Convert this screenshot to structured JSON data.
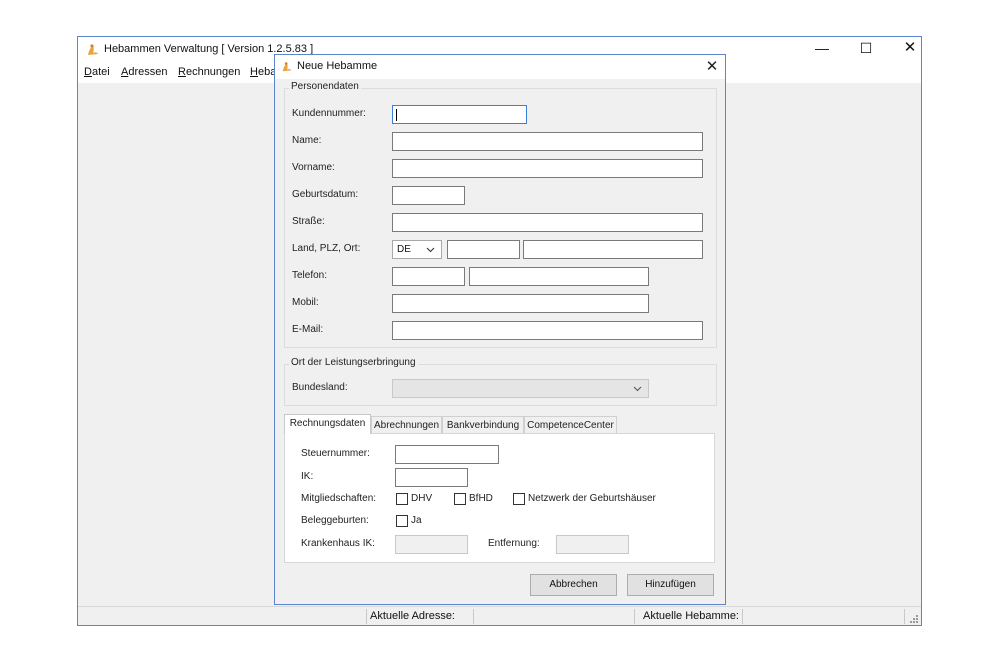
{
  "main": {
    "title": "Hebammen Verwaltung [ Version 1.2.5.83 ]",
    "controls": {
      "minimize": "—",
      "maximize": "☐",
      "close": "✕"
    },
    "menu": [
      {
        "underline": "D",
        "rest": "atei"
      },
      {
        "underline": "A",
        "rest": "dressen"
      },
      {
        "underline": "R",
        "rest": "echnungen"
      },
      {
        "underline": "H",
        "rest": "eba"
      }
    ],
    "status": {
      "aktuelle_adresse_label": "Aktuelle Adresse:",
      "aktuelle_hebamme_label": "Aktuelle Hebamme:"
    }
  },
  "dialog": {
    "title": "Neue Hebamme",
    "close": "✕",
    "personendaten": {
      "legend": "Personendaten",
      "labels": {
        "kundennummer": "Kundennummer:",
        "name": "Name:",
        "vorname": "Vorname:",
        "geburtsdatum": "Geburtsdatum:",
        "strasse": "Straße:",
        "land_plz_ort": "Land, PLZ, Ort:",
        "telefon": "Telefon:",
        "mobil": "Mobil:",
        "email": "E-Mail:"
      },
      "land_value": "DE"
    },
    "leistung": {
      "legend": "Ort der Leistungserbringung",
      "bundesland_label": "Bundesland:"
    },
    "tabs": [
      "Rechnungsdaten",
      "Abrechnungen",
      "Bankverbindung",
      "CompetenceCenter"
    ],
    "rechnungsdaten": {
      "steuernummer": "Steuernummer:",
      "ik": "IK:",
      "mitgliedschaften": "Mitgliedschaften:",
      "dhv": "DHV",
      "bfhd": "BfHD",
      "netzwerk": "Netzwerk der Geburtshäuser",
      "beleggeburten": "Beleggeburten:",
      "ja": "Ja",
      "krankenhaus_ik": "Krankenhaus IK:",
      "entfernung": "Entfernung:"
    },
    "buttons": {
      "cancel": "Abbrechen",
      "add": "Hinzufügen"
    }
  },
  "colors": {
    "window_border": "#5b86c9",
    "focus_border": "#3c7fd8",
    "background": "#f0f0f0"
  }
}
